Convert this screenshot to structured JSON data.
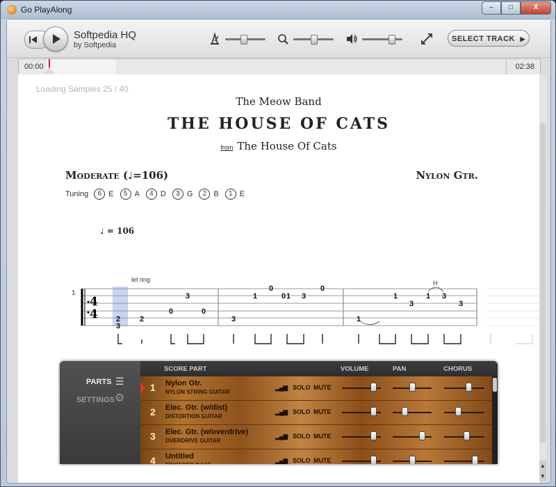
{
  "window": {
    "title": "Go PlayAlong",
    "minimize": "–",
    "maximize": "□",
    "close": "X"
  },
  "player": {
    "song_title": "Softpedia HQ",
    "song_artist": "by Softpedia",
    "time_current": "00:00",
    "time_total": "02:38",
    "select_track_label": "SELECT TRACK",
    "metronome_level": 0.45,
    "speed_level": 0.5,
    "volume_level": 0.72
  },
  "score": {
    "loading_text": "Loading Samples  25 / 40",
    "band": "The Meow Band",
    "title": "THE HOUSE OF CATS",
    "album_prefix": "from",
    "album": "The House Of Cats",
    "tempo_label": "Moderate (",
    "tempo_value": "=106)",
    "instrument": "Nylon Gtr.",
    "tuning_label": "Tuning",
    "tuning": [
      {
        "n": "6",
        "note": "E"
      },
      {
        "n": "5",
        "note": "A"
      },
      {
        "n": "4",
        "note": "D"
      },
      {
        "n": "3",
        "note": "G"
      },
      {
        "n": "2",
        "note": "B"
      },
      {
        "n": "1",
        "note": "E"
      }
    ],
    "tempo_mark": "= 106",
    "let_ring": "let ring",
    "measure_number": "1",
    "time_sig": "4",
    "hammer": "H"
  },
  "mixer": {
    "parts_label": "PARTS",
    "settings_label": "SETTINGS",
    "headers": {
      "score_part": "SCORE PART",
      "volume": "VOLUME",
      "pan": "PAN",
      "chorus": "CHORUS"
    },
    "solo_label": "SOLO",
    "mute_label": "MUTE",
    "tracks": [
      {
        "num": "1",
        "name": "Nylon Gtr.",
        "sub": "NYLON STRING GUITAR",
        "volume": 0.8,
        "pan": 0.5,
        "chorus": 0.6
      },
      {
        "num": "2",
        "name": "Elec. Gtr. (w/dist)",
        "sub": "DISTORTION GUITAR",
        "volume": 0.8,
        "pan": 0.3,
        "chorus": 0.35
      },
      {
        "num": "3",
        "name": "Elec. Gtr. (w/overdrive)",
        "sub": "OVERDRIVE GUITAR",
        "volume": 0.8,
        "pan": 0.75,
        "chorus": 0.55
      },
      {
        "num": "4",
        "name": "Untitled",
        "sub": "FINGERED BASS",
        "volume": 0.8,
        "pan": 0.5,
        "chorus": 0.75
      }
    ]
  }
}
